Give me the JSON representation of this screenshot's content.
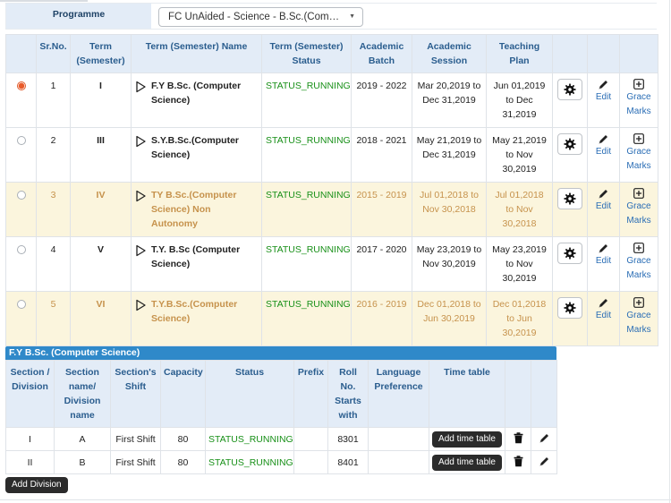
{
  "programme": {
    "label": "Programme",
    "selected": "FC UnAided - Science - B.Sc.(Com…"
  },
  "terms_table": {
    "headers": {
      "sr_no": "Sr.No.",
      "term": "Term (Semester)",
      "name": "Term (Semester) Name",
      "status": "Term (Semester) Status",
      "batch": "Academic Batch",
      "session": "Academic Session",
      "teaching": "Teaching Plan"
    },
    "edit_label": "Edit",
    "grace_label": "Grace Marks",
    "rows": [
      {
        "selected": true,
        "sr": "1",
        "term": "I",
        "name": "F.Y B.Sc. (Computer Science)",
        "status": "STATUS_RUNNING",
        "batch": "2019 - 2022",
        "session": "Mar 20,2019 to Dec 31,2019",
        "plan": "Jun 01,2019 to Dec 31,2019",
        "highlight": false
      },
      {
        "selected": false,
        "sr": "2",
        "term": "III",
        "name": "S.Y.B.Sc.(Computer Science)",
        "status": "STATUS_RUNNING",
        "batch": "2018 - 2021",
        "session": "May 21,2019 to Dec 31,2019",
        "plan": "May 21,2019 to Nov 30,2019",
        "highlight": false
      },
      {
        "selected": false,
        "sr": "3",
        "term": "IV",
        "name": "TY B.Sc.(Computer Science) Non Autonomy",
        "status": "STATUS_RUNNING",
        "batch": "2015 - 2019",
        "session": "Jul 01,2018 to Nov 30,2018",
        "plan": "Jul 01,2018 to Nov 30,2018",
        "highlight": true
      },
      {
        "selected": false,
        "sr": "4",
        "term": "V",
        "name": "T.Y. B.Sc (Computer Science)",
        "status": "STATUS_RUNNING",
        "batch": "2017 - 2020",
        "session": "May 23,2019 to Nov 30,2019",
        "plan": "May 23,2019 to Nov 30,2019",
        "highlight": false
      },
      {
        "selected": false,
        "sr": "5",
        "term": "VI",
        "name": "T.Y.B.Sc.(Computer Science)",
        "status": "STATUS_RUNNING",
        "batch": "2016 - 2019",
        "session": "Dec 01,2018 to Jun 30,2019",
        "plan": "Dec 01,2018 to Jun 30,2019",
        "highlight": true
      }
    ]
  },
  "division_section": {
    "title": "F.Y B.Sc. (Computer Science)",
    "headers": {
      "section": "Section / Division",
      "section_name": "Section name/ Division name",
      "shift": "Section's Shift",
      "capacity": "Capacity",
      "status": "Status",
      "prefix": "Prefix",
      "roll": "Roll No. Starts with",
      "language": "Language Preference",
      "timetable": "Time table"
    },
    "add_timetable_label": "Add time table",
    "rows": [
      {
        "section": "I",
        "name": "A",
        "shift": "First Shift",
        "capacity": "80",
        "status": "STATUS_RUNNING",
        "prefix": "",
        "roll": "8301",
        "language": ""
      },
      {
        "section": "II",
        "name": "B",
        "shift": "First Shift",
        "capacity": "80",
        "status": "STATUS_RUNNING",
        "prefix": "",
        "roll": "8401",
        "language": ""
      }
    ],
    "add_division_label": "Add Division"
  },
  "colors": {
    "header_bg": "#e3ecf7",
    "header_text": "#2a5d8e",
    "status_green": "#189018",
    "highlight_row": "#fbf5dd",
    "section_bar": "#2f89c9",
    "dark_button": "#2b2b2b",
    "selected_radio": "#e95b2a"
  },
  "icons": [
    "play-outline-icon",
    "gear-icon",
    "pencil-icon",
    "plus-square-icon",
    "trash-icon",
    "chevron-down-icon"
  ]
}
